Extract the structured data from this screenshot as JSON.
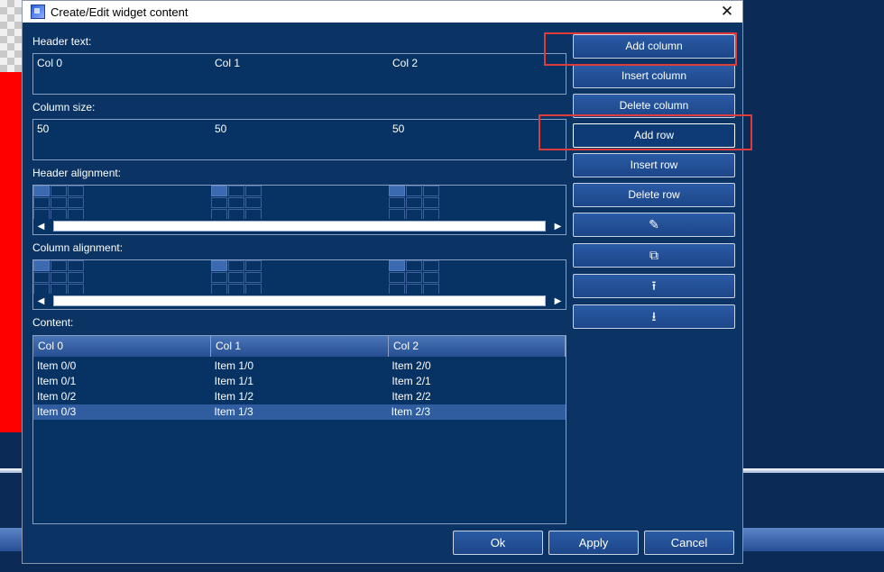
{
  "dialog": {
    "title": "Create/Edit widget content",
    "close_symbol": "✕"
  },
  "labels": {
    "header_text": "Header text:",
    "column_size": "Column size:",
    "header_alignment": "Header alignment:",
    "column_alignment": "Column alignment:",
    "content": "Content:"
  },
  "header_text_values": [
    "Col 0",
    "Col 1",
    "Col 2"
  ],
  "column_size_values": [
    "50",
    "50",
    "50"
  ],
  "content_table": {
    "columns": [
      "Col 0",
      "Col 1",
      "Col 2"
    ],
    "rows": [
      [
        "Item 0/0",
        "Item 1/0",
        "Item 2/0"
      ],
      [
        "Item 0/1",
        "Item 1/1",
        "Item 2/1"
      ],
      [
        "Item 0/2",
        "Item 1/2",
        "Item 2/2"
      ],
      [
        "Item 0/3",
        "Item 1/3",
        "Item 2/3"
      ]
    ],
    "selected_row": 3
  },
  "side_buttons": {
    "add_column": "Add column",
    "insert_column": "Insert column",
    "delete_column": "Delete column",
    "add_row": "Add row",
    "insert_row": "Insert row",
    "delete_row": "Delete row",
    "edit_icon": "pencil-icon",
    "copy_icon": "duplicate-icon",
    "move_up_icon": "move-up-icon",
    "move_down_icon": "move-down-icon"
  },
  "footer": {
    "ok": "Ok",
    "apply": "Apply",
    "cancel": "Cancel"
  },
  "colors": {
    "dialog_bg": "#0b3464",
    "highlight": "#e03b3b",
    "selected_row": "#2f5da0"
  }
}
